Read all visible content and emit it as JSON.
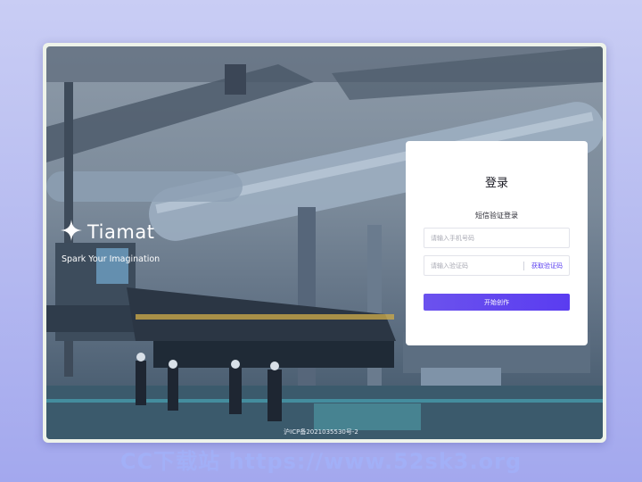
{
  "brand": {
    "name": "Tiamat",
    "tagline": "Spark Your Imagination"
  },
  "login": {
    "title": "登录",
    "subtitle": "短信验证登录",
    "phone_placeholder": "请输入手机号码",
    "code_placeholder": "请输入验证码",
    "get_code_label": "获取验证码",
    "submit_label": "开始创作"
  },
  "footer": {
    "icp": "沪ICP备2021035530号-2"
  },
  "watermark": "CC下载站 https://www.52sk3.org",
  "colors": {
    "accent": "#5a3cf0",
    "background": "#b4b9f0"
  }
}
